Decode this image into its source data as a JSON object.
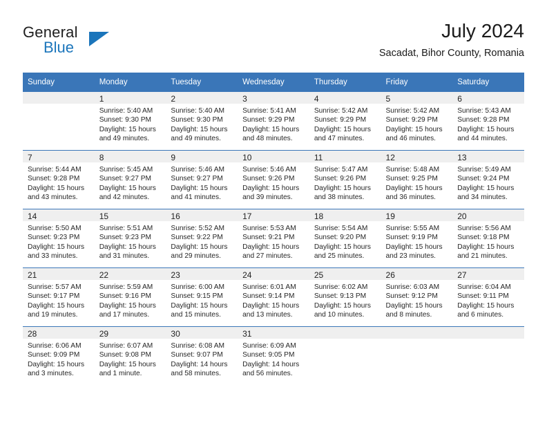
{
  "brand": {
    "name_part1": "General",
    "name_part2": "Blue"
  },
  "header": {
    "title": "July 2024",
    "subtitle": "Sacadat, Bihor County, Romania"
  },
  "colors": {
    "header_blue": "#3A76B8",
    "brand_blue": "#1B75BB",
    "daynum_band": "#EFEFEF"
  },
  "weekday_headers": [
    "Sunday",
    "Monday",
    "Tuesday",
    "Wednesday",
    "Thursday",
    "Friday",
    "Saturday"
  ],
  "weeks": [
    [
      {
        "day": "",
        "sunrise": "",
        "sunset": "",
        "daylight_line1": "",
        "daylight_line2": ""
      },
      {
        "day": "1",
        "sunrise": "Sunrise: 5:40 AM",
        "sunset": "Sunset: 9:30 PM",
        "daylight_line1": "Daylight: 15 hours",
        "daylight_line2": "and 49 minutes."
      },
      {
        "day": "2",
        "sunrise": "Sunrise: 5:40 AM",
        "sunset": "Sunset: 9:30 PM",
        "daylight_line1": "Daylight: 15 hours",
        "daylight_line2": "and 49 minutes."
      },
      {
        "day": "3",
        "sunrise": "Sunrise: 5:41 AM",
        "sunset": "Sunset: 9:29 PM",
        "daylight_line1": "Daylight: 15 hours",
        "daylight_line2": "and 48 minutes."
      },
      {
        "day": "4",
        "sunrise": "Sunrise: 5:42 AM",
        "sunset": "Sunset: 9:29 PM",
        "daylight_line1": "Daylight: 15 hours",
        "daylight_line2": "and 47 minutes."
      },
      {
        "day": "5",
        "sunrise": "Sunrise: 5:42 AM",
        "sunset": "Sunset: 9:29 PM",
        "daylight_line1": "Daylight: 15 hours",
        "daylight_line2": "and 46 minutes."
      },
      {
        "day": "6",
        "sunrise": "Sunrise: 5:43 AM",
        "sunset": "Sunset: 9:28 PM",
        "daylight_line1": "Daylight: 15 hours",
        "daylight_line2": "and 44 minutes."
      }
    ],
    [
      {
        "day": "7",
        "sunrise": "Sunrise: 5:44 AM",
        "sunset": "Sunset: 9:28 PM",
        "daylight_line1": "Daylight: 15 hours",
        "daylight_line2": "and 43 minutes."
      },
      {
        "day": "8",
        "sunrise": "Sunrise: 5:45 AM",
        "sunset": "Sunset: 9:27 PM",
        "daylight_line1": "Daylight: 15 hours",
        "daylight_line2": "and 42 minutes."
      },
      {
        "day": "9",
        "sunrise": "Sunrise: 5:46 AM",
        "sunset": "Sunset: 9:27 PM",
        "daylight_line1": "Daylight: 15 hours",
        "daylight_line2": "and 41 minutes."
      },
      {
        "day": "10",
        "sunrise": "Sunrise: 5:46 AM",
        "sunset": "Sunset: 9:26 PM",
        "daylight_line1": "Daylight: 15 hours",
        "daylight_line2": "and 39 minutes."
      },
      {
        "day": "11",
        "sunrise": "Sunrise: 5:47 AM",
        "sunset": "Sunset: 9:26 PM",
        "daylight_line1": "Daylight: 15 hours",
        "daylight_line2": "and 38 minutes."
      },
      {
        "day": "12",
        "sunrise": "Sunrise: 5:48 AM",
        "sunset": "Sunset: 9:25 PM",
        "daylight_line1": "Daylight: 15 hours",
        "daylight_line2": "and 36 minutes."
      },
      {
        "day": "13",
        "sunrise": "Sunrise: 5:49 AM",
        "sunset": "Sunset: 9:24 PM",
        "daylight_line1": "Daylight: 15 hours",
        "daylight_line2": "and 34 minutes."
      }
    ],
    [
      {
        "day": "14",
        "sunrise": "Sunrise: 5:50 AM",
        "sunset": "Sunset: 9:23 PM",
        "daylight_line1": "Daylight: 15 hours",
        "daylight_line2": "and 33 minutes."
      },
      {
        "day": "15",
        "sunrise": "Sunrise: 5:51 AM",
        "sunset": "Sunset: 9:23 PM",
        "daylight_line1": "Daylight: 15 hours",
        "daylight_line2": "and 31 minutes."
      },
      {
        "day": "16",
        "sunrise": "Sunrise: 5:52 AM",
        "sunset": "Sunset: 9:22 PM",
        "daylight_line1": "Daylight: 15 hours",
        "daylight_line2": "and 29 minutes."
      },
      {
        "day": "17",
        "sunrise": "Sunrise: 5:53 AM",
        "sunset": "Sunset: 9:21 PM",
        "daylight_line1": "Daylight: 15 hours",
        "daylight_line2": "and 27 minutes."
      },
      {
        "day": "18",
        "sunrise": "Sunrise: 5:54 AM",
        "sunset": "Sunset: 9:20 PM",
        "daylight_line1": "Daylight: 15 hours",
        "daylight_line2": "and 25 minutes."
      },
      {
        "day": "19",
        "sunrise": "Sunrise: 5:55 AM",
        "sunset": "Sunset: 9:19 PM",
        "daylight_line1": "Daylight: 15 hours",
        "daylight_line2": "and 23 minutes."
      },
      {
        "day": "20",
        "sunrise": "Sunrise: 5:56 AM",
        "sunset": "Sunset: 9:18 PM",
        "daylight_line1": "Daylight: 15 hours",
        "daylight_line2": "and 21 minutes."
      }
    ],
    [
      {
        "day": "21",
        "sunrise": "Sunrise: 5:57 AM",
        "sunset": "Sunset: 9:17 PM",
        "daylight_line1": "Daylight: 15 hours",
        "daylight_line2": "and 19 minutes."
      },
      {
        "day": "22",
        "sunrise": "Sunrise: 5:59 AM",
        "sunset": "Sunset: 9:16 PM",
        "daylight_line1": "Daylight: 15 hours",
        "daylight_line2": "and 17 minutes."
      },
      {
        "day": "23",
        "sunrise": "Sunrise: 6:00 AM",
        "sunset": "Sunset: 9:15 PM",
        "daylight_line1": "Daylight: 15 hours",
        "daylight_line2": "and 15 minutes."
      },
      {
        "day": "24",
        "sunrise": "Sunrise: 6:01 AM",
        "sunset": "Sunset: 9:14 PM",
        "daylight_line1": "Daylight: 15 hours",
        "daylight_line2": "and 13 minutes."
      },
      {
        "day": "25",
        "sunrise": "Sunrise: 6:02 AM",
        "sunset": "Sunset: 9:13 PM",
        "daylight_line1": "Daylight: 15 hours",
        "daylight_line2": "and 10 minutes."
      },
      {
        "day": "26",
        "sunrise": "Sunrise: 6:03 AM",
        "sunset": "Sunset: 9:12 PM",
        "daylight_line1": "Daylight: 15 hours",
        "daylight_line2": "and 8 minutes."
      },
      {
        "day": "27",
        "sunrise": "Sunrise: 6:04 AM",
        "sunset": "Sunset: 9:11 PM",
        "daylight_line1": "Daylight: 15 hours",
        "daylight_line2": "and 6 minutes."
      }
    ],
    [
      {
        "day": "28",
        "sunrise": "Sunrise: 6:06 AM",
        "sunset": "Sunset: 9:09 PM",
        "daylight_line1": "Daylight: 15 hours",
        "daylight_line2": "and 3 minutes."
      },
      {
        "day": "29",
        "sunrise": "Sunrise: 6:07 AM",
        "sunset": "Sunset: 9:08 PM",
        "daylight_line1": "Daylight: 15 hours",
        "daylight_line2": "and 1 minute."
      },
      {
        "day": "30",
        "sunrise": "Sunrise: 6:08 AM",
        "sunset": "Sunset: 9:07 PM",
        "daylight_line1": "Daylight: 14 hours",
        "daylight_line2": "and 58 minutes."
      },
      {
        "day": "31",
        "sunrise": "Sunrise: 6:09 AM",
        "sunset": "Sunset: 9:05 PM",
        "daylight_line1": "Daylight: 14 hours",
        "daylight_line2": "and 56 minutes."
      },
      {
        "day": "",
        "sunrise": "",
        "sunset": "",
        "daylight_line1": "",
        "daylight_line2": ""
      },
      {
        "day": "",
        "sunrise": "",
        "sunset": "",
        "daylight_line1": "",
        "daylight_line2": ""
      },
      {
        "day": "",
        "sunrise": "",
        "sunset": "",
        "daylight_line1": "",
        "daylight_line2": ""
      }
    ]
  ]
}
